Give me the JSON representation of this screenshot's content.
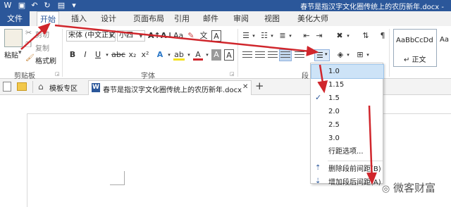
{
  "window": {
    "title": "春节是指汉字文化圈传统上的农历新年.docx -"
  },
  "tabs": [
    "文件",
    "开始",
    "插入",
    "设计",
    "页面布局",
    "引用",
    "邮件",
    "审阅",
    "视图",
    "美化大师"
  ],
  "clipboard": {
    "cut": "剪切",
    "copy": "复制",
    "paste": "粘贴",
    "format_painter": "格式刷",
    "group_label": "剪贴板"
  },
  "font": {
    "name": "宋体 (中文正文)",
    "size": "小四",
    "group_label": "字体",
    "bold": "B",
    "italic": "I",
    "underline": "U",
    "strike": "abc",
    "sub": "x₂",
    "sup": "x²",
    "text_effects": "A",
    "highlight": "ab",
    "font_color": "A",
    "char_shading": "A"
  },
  "paragraph": {
    "group_label": "段"
  },
  "styles": {
    "sample": "AaBbCcDd",
    "name": "↵ 正文"
  },
  "filetabs": {
    "templates": "模板专区",
    "doc": "春节是指汉字文化圈传统上的农历新年.docx",
    "close": "✕",
    "add": "+"
  },
  "menu": {
    "items": [
      "1.0",
      "1.15",
      "1.5",
      "2.0",
      "2.5",
      "3.0",
      "行距选项...",
      "删除段前间距(B)",
      "增加段后间距(A)"
    ],
    "checked_index": 2
  },
  "watermark": "微客财富",
  "colors": {
    "accent": "#2b579a",
    "arrow": "#d0262c"
  }
}
